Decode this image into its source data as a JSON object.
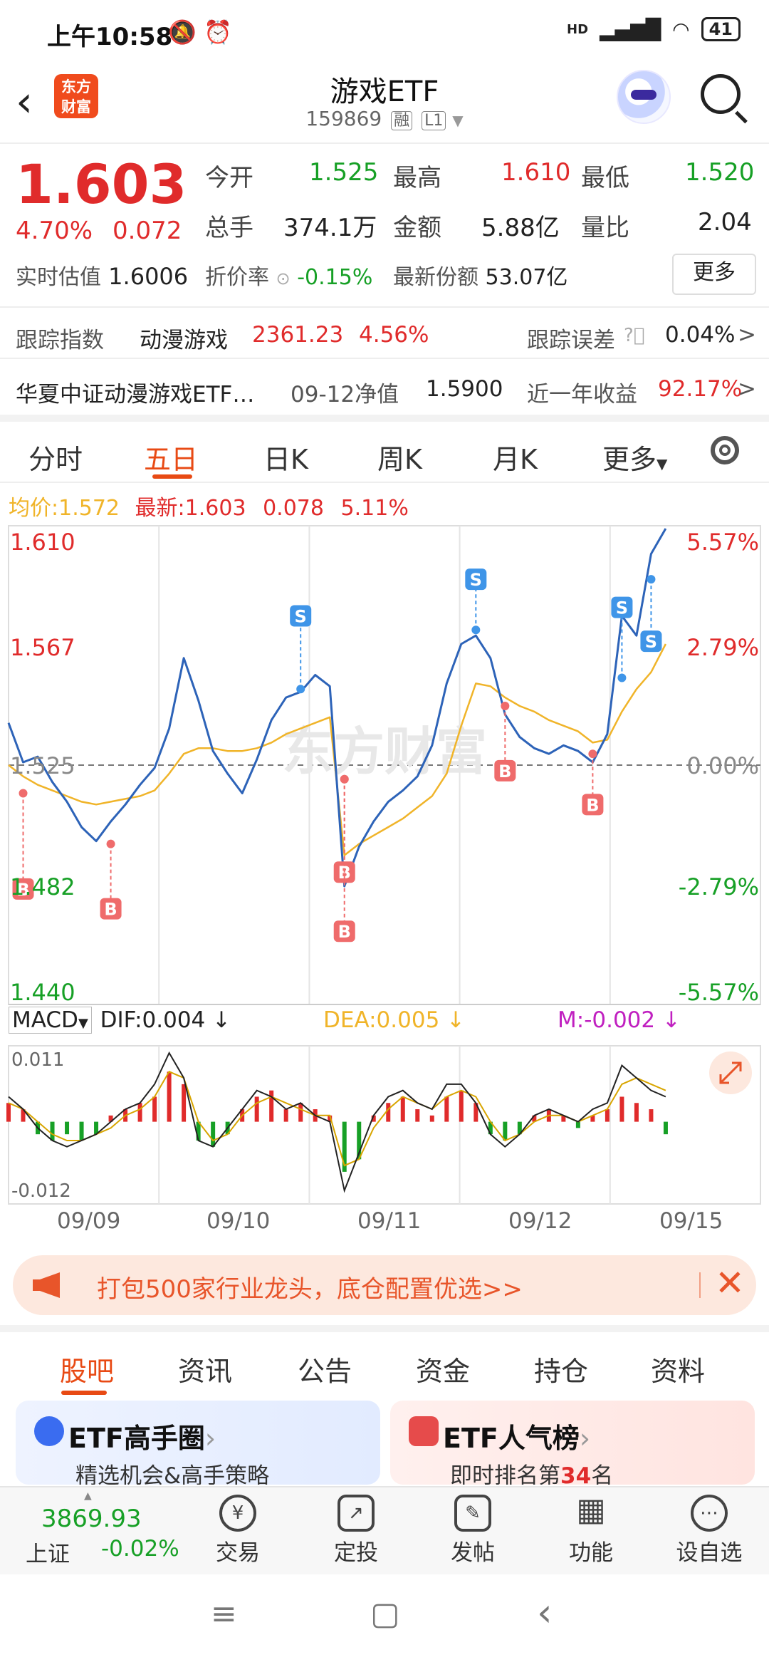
{
  "status": {
    "time": "上午10:58",
    "battery": "41",
    "network": "HD"
  },
  "header": {
    "back": "‹",
    "brand": "东方财富",
    "title": "游戏ETF",
    "code": "159869",
    "tag1": "融",
    "tag2": "L1"
  },
  "quote": {
    "price": "1.603",
    "pct": "4.70%",
    "chg": "0.072",
    "open_k": "今开",
    "open_v": "1.525",
    "high_k": "最高",
    "high_v": "1.610",
    "low_k": "最低",
    "low_v": "1.520",
    "vol_k": "总手",
    "vol_v": "374.1万",
    "amt_k": "金额",
    "amt_v": "5.88亿",
    "ratio_k": "量比",
    "ratio_v": "2.04",
    "est_k": "实时估值",
    "est_v": "1.6006",
    "disc_k": "折价率",
    "disc_v": "-0.15%",
    "share_k": "最新份额",
    "share_v": "53.07亿",
    "more": "更多"
  },
  "track": {
    "idx_k": "跟踪指数",
    "idx_name": "动漫游戏",
    "idx_v": "2361.23",
    "idx_pct": "4.56%",
    "err_k": "跟踪误差",
    "err_v": "0.04%",
    "fund_name": "华夏中证动漫游戏ETF…",
    "nav_k": "09-12净值",
    "nav_v": "1.5900",
    "yr_k": "近一年收益",
    "yr_v": "92.17%",
    "arrow": ">"
  },
  "chart_tabs": [
    "分时",
    "五日",
    "日K",
    "周K",
    "月K",
    "更多"
  ],
  "legend": {
    "avg_k": "均价:",
    "avg_v": "1.572",
    "last_k": "最新:",
    "last_v": "1.603",
    "last_chg": "0.078",
    "last_pct": "5.11%"
  },
  "macd": {
    "name": "MACD",
    "dif": "DIF:0.004",
    "dea": "DEA:0.005",
    "m": "M:-0.002",
    "top": "0.011",
    "bottom": "-0.012"
  },
  "watermark": "东方财富",
  "chart_data": {
    "type": "line",
    "title": "",
    "x_days": [
      "09/09",
      "09/10",
      "09/11",
      "09/12",
      "09/15"
    ],
    "y_left_ticks": [
      "1.610",
      "1.567",
      "1.525",
      "1.482",
      "1.440"
    ],
    "y_right_ticks": [
      "5.57%",
      "2.79%",
      "0.00%",
      "-2.79%",
      "-5.57%"
    ],
    "ylim": [
      1.44,
      1.61
    ],
    "prev_close": 1.525,
    "series": [
      {
        "name": "",
        "color": "#2d63b8",
        "values": [
          1.54,
          1.526,
          1.528,
          1.519,
          1.512,
          1.503,
          1.498,
          1.505,
          1.511,
          1.518,
          1.524,
          1.538,
          1.563,
          1.548,
          1.53,
          1.522,
          1.515,
          1.527,
          1.541,
          1.549,
          1.551,
          1.557,
          1.553,
          1.482,
          1.496,
          1.505,
          1.512,
          1.516,
          1.521,
          1.532,
          1.554,
          1.568,
          1.571,
          1.563,
          1.543,
          1.535,
          1.531,
          1.529,
          1.532,
          1.53,
          1.526,
          1.536,
          1.578,
          1.571,
          1.6,
          1.609
        ]
      },
      {
        "name": "",
        "color": "#f0b429",
        "values": [
          1.525,
          1.521,
          1.518,
          1.516,
          1.514,
          1.512,
          1.511,
          1.512,
          1.513,
          1.514,
          1.516,
          1.522,
          1.529,
          1.531,
          1.531,
          1.53,
          1.53,
          1.531,
          1.533,
          1.536,
          1.538,
          1.54,
          1.542,
          1.493,
          1.497,
          1.5,
          1.503,
          1.506,
          1.51,
          1.514,
          1.522,
          1.539,
          1.554,
          1.553,
          1.549,
          1.546,
          1.544,
          1.541,
          1.539,
          1.537,
          1.533,
          1.534,
          1.544,
          1.552,
          1.558,
          1.568
        ]
      }
    ],
    "signals": [
      {
        "label": "B",
        "index": 1,
        "value": 1.481,
        "dot": 1.515
      },
      {
        "label": "B",
        "index": 7,
        "value": 1.474,
        "dot": 1.497
      },
      {
        "label": "S",
        "index": 20,
        "value": 1.578,
        "dot": 1.552
      },
      {
        "label": "B",
        "index": 23,
        "value": 1.487,
        "dot": 1.52
      },
      {
        "label": "B",
        "index": 23,
        "value": 1.466,
        "dot": 1.52
      },
      {
        "label": "S",
        "index": 32,
        "value": 1.591,
        "dot": 1.573
      },
      {
        "label": "B",
        "index": 34,
        "value": 1.523,
        "dot": 1.546
      },
      {
        "label": "B",
        "index": 40,
        "value": 1.511,
        "dot": 1.529
      },
      {
        "label": "S",
        "index": 42,
        "value": 1.581,
        "dot": 1.556
      },
      {
        "label": "S",
        "index": 44,
        "value": 1.569,
        "dot": 1.591
      }
    ],
    "macd_hist": [
      0.003,
      0.002,
      -0.002,
      -0.003,
      -0.002,
      -0.003,
      -0.002,
      0.001,
      0.002,
      0.003,
      0.004,
      0.008,
      0.006,
      -0.003,
      -0.004,
      -0.002,
      0.002,
      0.004,
      0.005,
      0.002,
      0.003,
      0.002,
      0.001,
      -0.008,
      -0.006,
      0.001,
      0.003,
      0.004,
      0.002,
      0.001,
      0.004,
      0.005,
      0.003,
      -0.002,
      -0.003,
      -0.002,
      0.001,
      0.002,
      0.001,
      -0.001,
      0.001,
      0.002,
      0.004,
      0.003,
      0.002,
      -0.002
    ],
    "macd_dif": [
      0.004,
      0.002,
      -0.001,
      -0.003,
      -0.004,
      -0.003,
      -0.002,
      0.0,
      0.002,
      0.003,
      0.006,
      0.011,
      0.007,
      -0.003,
      -0.004,
      -0.001,
      0.002,
      0.005,
      0.004,
      0.002,
      0.003,
      0.001,
      0.0,
      -0.011,
      -0.005,
      0.001,
      0.004,
      0.005,
      0.003,
      0.002,
      0.006,
      0.006,
      0.003,
      -0.002,
      -0.004,
      -0.002,
      0.001,
      0.002,
      0.001,
      0.0,
      0.002,
      0.003,
      0.009,
      0.007,
      0.005,
      0.004
    ],
    "macd_dea": [
      0.003,
      0.002,
      0.0,
      -0.002,
      -0.003,
      -0.003,
      -0.002,
      -0.001,
      0.001,
      0.002,
      0.004,
      0.008,
      0.007,
      0.0,
      -0.003,
      -0.002,
      0.001,
      0.003,
      0.004,
      0.003,
      0.002,
      0.001,
      0.001,
      -0.007,
      -0.006,
      -0.001,
      0.002,
      0.004,
      0.003,
      0.002,
      0.004,
      0.005,
      0.004,
      0.0,
      -0.003,
      -0.002,
      0.0,
      0.001,
      0.001,
      0.0,
      0.001,
      0.002,
      0.006,
      0.007,
      0.006,
      0.005
    ],
    "macd_ylim": [
      -0.012,
      0.011
    ]
  },
  "ad": {
    "text": "打包500家行业龙头，底仓配置优选>>",
    "close": "✕"
  },
  "bottom_tabs": [
    "股吧",
    "资讯",
    "公告",
    "资金",
    "持仓",
    "资料"
  ],
  "cards": [
    {
      "title": "ETF高手圈",
      "desc": "精选机会&高手策略",
      "arrow": "›"
    },
    {
      "title": "ETF人气榜",
      "desc_pre": "即时排名第",
      "rank": "34",
      "desc_post": "名",
      "arrow": "›"
    }
  ],
  "nav": {
    "index_value": "3869.93",
    "index_name": "上证",
    "index_chg": "-0.02%",
    "items": [
      {
        "label": "交易",
        "icon": "¥"
      },
      {
        "label": "定投",
        "icon": "↗"
      },
      {
        "label": "发帖",
        "icon": "✎"
      },
      {
        "label": "功能",
        "icon": "▦"
      },
      {
        "label": "设自选",
        "icon": "⋯"
      }
    ]
  },
  "sysnav": {
    "menu": "≡",
    "home": "▢",
    "back": "‹"
  }
}
